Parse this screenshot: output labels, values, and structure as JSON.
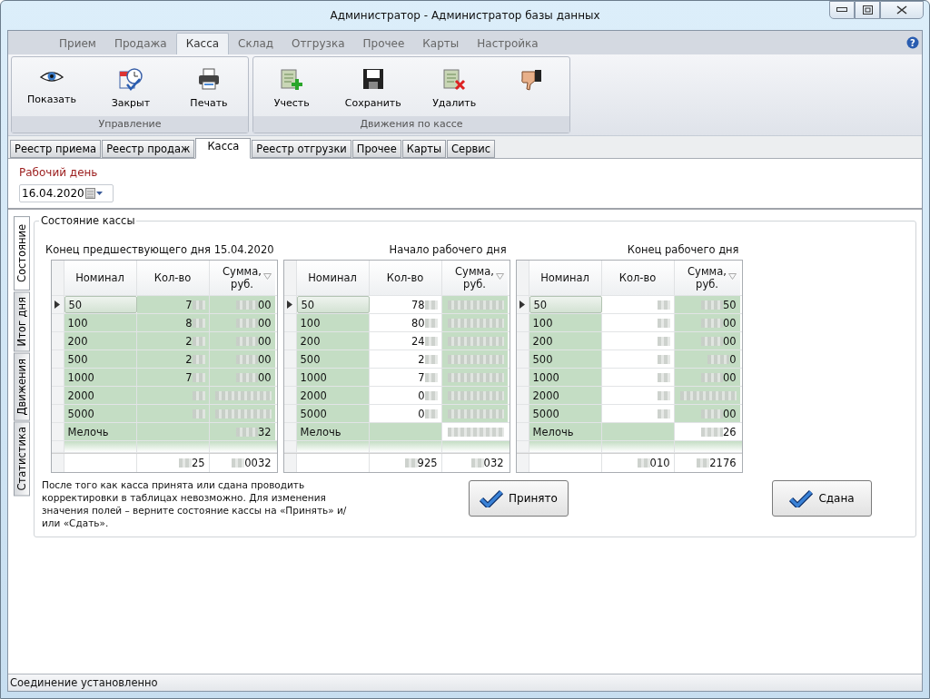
{
  "window": {
    "title": "Администратор - Администратор базы данных"
  },
  "ribbon_tabs": [
    {
      "label": "Прием",
      "selected": false
    },
    {
      "label": "Продажа",
      "selected": false
    },
    {
      "label": "Касса",
      "selected": true
    },
    {
      "label": "Склад",
      "selected": false
    },
    {
      "label": "Отгрузка",
      "selected": false
    },
    {
      "label": "Прочее",
      "selected": false
    },
    {
      "label": "Карты",
      "selected": false
    },
    {
      "label": "Настройка",
      "selected": false
    }
  ],
  "ribbon_groups": [
    {
      "title": "Управление",
      "buttons": [
        {
          "label": "Показать",
          "kind": "eye"
        },
        {
          "label": "Закрыт",
          "kind": "calendar"
        },
        {
          "label": "Печать",
          "kind": "printer"
        }
      ]
    },
    {
      "title": "Движения по кассе",
      "buttons": [
        {
          "label": "Учесть",
          "kind": "add"
        },
        {
          "label": "Сохранить",
          "kind": "save"
        },
        {
          "label": "Удалить",
          "kind": "delete"
        },
        {
          "kind": "dislike"
        }
      ]
    }
  ],
  "help_glyph": "?",
  "doc_tabs": [
    {
      "label": "Реестр приема",
      "selected": false
    },
    {
      "label": "Реестр продаж",
      "selected": false
    },
    {
      "label": "Касса",
      "selected": true
    },
    {
      "label": "Реестр отгрузки",
      "selected": false
    },
    {
      "label": "Прочее",
      "selected": false
    },
    {
      "label": "Карты",
      "selected": false
    },
    {
      "label": "Сервис",
      "selected": false
    }
  ],
  "work_day": {
    "label": "Рабочий день",
    "value": "16.04.2020"
  },
  "side_tabs": [
    {
      "label": "Состояние",
      "selected": true
    },
    {
      "label": "Итог дня",
      "selected": false
    },
    {
      "label": "Движения",
      "selected": false
    },
    {
      "label": "Статистика",
      "selected": false
    }
  ],
  "group_title": "Состояние кассы",
  "tables": [
    {
      "title": "Конец предшествующего дня 15.04.2020",
      "columns": [
        "Номинал",
        "Кол-во",
        "Сумма, руб."
      ],
      "values_pixelated": true,
      "rows": [
        {
          "nominal": "50",
          "qty": "7",
          "sum": "00",
          "nominal_green": true,
          "qty_green": true,
          "sum_green": true
        },
        {
          "nominal": "100",
          "qty": "8",
          "sum": "00",
          "nominal_green": true,
          "qty_green": true,
          "sum_green": true
        },
        {
          "nominal": "200",
          "qty": "2",
          "sum": "00",
          "nominal_green": true,
          "qty_green": true,
          "sum_green": true
        },
        {
          "nominal": "500",
          "qty": "2",
          "sum": "00",
          "nominal_green": true,
          "qty_green": true,
          "sum_green": true
        },
        {
          "nominal": "1000",
          "qty": "7",
          "sum": "00",
          "nominal_green": true,
          "qty_green": true,
          "sum_green": true
        },
        {
          "nominal": "2000",
          "qty": "",
          "sum": "",
          "nominal_green": true,
          "qty_green": true,
          "sum_green": true
        },
        {
          "nominal": "5000",
          "qty": "",
          "sum": "",
          "nominal_green": true,
          "qty_green": true,
          "sum_green": true
        },
        {
          "nominal": "Мелочь",
          "qty": "",
          "sum": "32",
          "nominal_green": true,
          "qty_green": true,
          "sum_green": true
        }
      ],
      "total_qty": "25",
      "total_sum": "0032"
    },
    {
      "title": "Начало рабочего дня",
      "columns": [
        "Номинал",
        "Кол-во",
        "Сумма, руб."
      ],
      "values_pixelated": true,
      "rows": [
        {
          "nominal": "50",
          "qty": "78",
          "sum": "",
          "nominal_green": true,
          "qty_green": false,
          "sum_green": true
        },
        {
          "nominal": "100",
          "qty": "80",
          "sum": "",
          "nominal_green": true,
          "qty_green": false,
          "sum_green": true
        },
        {
          "nominal": "200",
          "qty": "24",
          "sum": "",
          "nominal_green": true,
          "qty_green": false,
          "sum_green": true
        },
        {
          "nominal": "500",
          "qty": "2",
          "sum": "",
          "nominal_green": true,
          "qty_green": false,
          "sum_green": true
        },
        {
          "nominal": "1000",
          "qty": "7",
          "sum": "",
          "nominal_green": true,
          "qty_green": false,
          "sum_green": true
        },
        {
          "nominal": "2000",
          "qty": "0",
          "sum": "",
          "nominal_green": true,
          "qty_green": false,
          "sum_green": true
        },
        {
          "nominal": "5000",
          "qty": "0",
          "sum": "",
          "nominal_green": true,
          "qty_green": false,
          "sum_green": true
        },
        {
          "nominal": "Мелочь",
          "qty": "",
          "sum": "",
          "nominal_green": true,
          "qty_green": true,
          "sum_green": false
        }
      ],
      "total_qty": "925",
      "total_sum": "032"
    },
    {
      "title": "Конец рабочего дня",
      "columns": [
        "Номинал",
        "Кол-во",
        "Сумма, руб."
      ],
      "values_pixelated": true,
      "rows": [
        {
          "nominal": "50",
          "qty": "",
          "sum": "50",
          "nominal_green": true,
          "qty_green": false,
          "sum_green": true
        },
        {
          "nominal": "100",
          "qty": "",
          "sum": "00",
          "nominal_green": true,
          "qty_green": false,
          "sum_green": true
        },
        {
          "nominal": "200",
          "qty": "",
          "sum": "00",
          "nominal_green": true,
          "qty_green": false,
          "sum_green": true
        },
        {
          "nominal": "500",
          "qty": "",
          "sum": "0",
          "nominal_green": true,
          "qty_green": false,
          "sum_green": true
        },
        {
          "nominal": "1000",
          "qty": "",
          "sum": "00",
          "nominal_green": true,
          "qty_green": false,
          "sum_green": true
        },
        {
          "nominal": "2000",
          "qty": "",
          "sum": "",
          "nominal_green": true,
          "qty_green": false,
          "sum_green": true
        },
        {
          "nominal": "5000",
          "qty": "",
          "sum": "00",
          "nominal_green": true,
          "qty_green": false,
          "sum_green": true
        },
        {
          "nominal": "Мелочь",
          "qty": "",
          "sum": "26",
          "nominal_green": true,
          "qty_green": true,
          "sum_green": false
        }
      ],
      "total_qty": "010",
      "total_sum": "2176"
    }
  ],
  "note": "После того как касса принята или сдана проводить корректировки в таблицах невозможно. Для изменения значения полей – верните состояние кассы на «Принять» и/или «Сдать».",
  "action_buttons": [
    {
      "label": "Принято"
    },
    {
      "label": "Сдана"
    }
  ],
  "status_bar": "Соединение установленно"
}
